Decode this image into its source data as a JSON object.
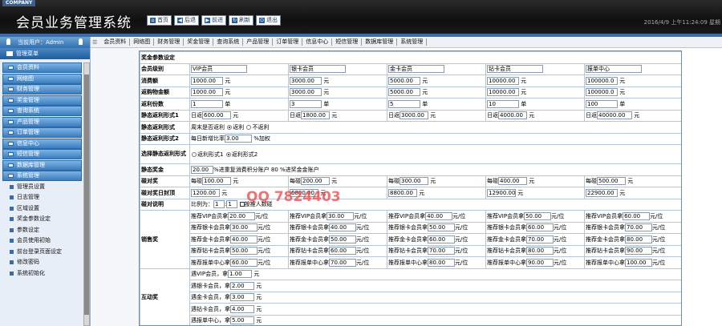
{
  "header": {
    "company": "COMPANY",
    "title": "会员业务管理系统",
    "nav": [
      "首页",
      "后退",
      "前进",
      "刷新",
      "退出"
    ],
    "datetime": "2016/4/9 上午11:24:09 星期"
  },
  "sidebar": {
    "user": "当前用户：Admin",
    "title": "管理菜单",
    "menu": [
      "会员资料",
      "网络图",
      "财务管理",
      "奖金管理",
      "查询系统",
      "产品管理",
      "订单管理",
      "信息中心",
      "短信管理",
      "数据库管理",
      "系统管理"
    ],
    "sub": [
      "管理员设置",
      "日志管理",
      "区域设置",
      "奖金参数设定",
      "参数设定",
      "会员使用初始",
      "前台登录页面设定",
      "修改密码",
      "系统初始化"
    ]
  },
  "tabs": [
    "会员资料",
    "网络图",
    "财务管理",
    "奖金管理",
    "查询系统",
    "产品管理",
    "订单管理",
    "信息中心",
    "短信管理",
    "数据库管理",
    "系统管理"
  ],
  "form": {
    "section": "奖金参数设定",
    "rows": {
      "level": {
        "label": "会员级别",
        "values": [
          "VIP会员",
          "银卡会员",
          "金卡会员",
          "钻卡会员",
          "报单中心"
        ]
      },
      "consume": {
        "label": "消费额",
        "values": [
          "1000.00",
          "3000.00",
          "5000.00",
          "10000.00",
          "100000.0"
        ],
        "unit": "元"
      },
      "repurchase": {
        "label": "返购物金额",
        "values": [
          "1000.00",
          "3000.00",
          "5000.00",
          "10000.00",
          "100000.0"
        ],
        "unit": "元"
      },
      "share": {
        "label": "返利份数",
        "values": [
          "1",
          "3",
          "5",
          "10",
          "100"
        ],
        "unit": "单"
      },
      "static1": {
        "label": "静态返利形式1",
        "prefix": "日返",
        "values": [
          "600.00",
          "1800.00",
          "3000.00",
          "4000.00",
          "40000.00"
        ],
        "unit": "元"
      },
      "static_mode": {
        "label": "静态返利形式",
        "text": "周末是否返利",
        "opt1": "返利",
        "opt2": "不返利"
      },
      "static2": {
        "label": "静态返利形式2",
        "text": "每日新增比率",
        "value": "3.00",
        "unit": "%加权"
      },
      "select_static": {
        "label": "选择静态返利形式",
        "opt1": "返利形式1",
        "opt2": "返利形式2"
      },
      "static_bonus": {
        "label": "静态奖金",
        "value": "20.00",
        "text": "%进重复消费积分账户 80 %进奖金金账户"
      },
      "pair": {
        "label": "碰对奖",
        "prefix": "每碰",
        "values": [
          "100.00",
          "200.00",
          "300.00",
          "400.00",
          "500.00"
        ],
        "unit": "元"
      },
      "cap": {
        "label": "碰对奖日封顶",
        "values": [
          "1200.00",
          "6800.00",
          "8800.00",
          "12900.00",
          "22900.00"
        ],
        "unit": "元"
      },
      "pair_desc": {
        "label": "碰对说明",
        "text1": "比例为：",
        "v1": "1",
        "text2": ":",
        "v2": "1",
        "text3": "按推人数碰"
      },
      "sales": {
        "label": "销售奖",
        "unit": "元/位",
        "rows": [
          [
            "推荐VIP会员拿",
            "20.00",
            "推荐VIP会员拿",
            "30.00",
            "推荐VIP会员拿",
            "40.00",
            "推荐VIP会员拿",
            "50.00",
            "推荐VIP会员拿",
            "60.00"
          ],
          [
            "推荐银卡会员拿",
            "30.00",
            "推荐银卡会员拿",
            "40.00",
            "推荐银卡会员拿",
            "50.00",
            "推荐银卡会员拿",
            "60.00",
            "推荐银卡会员拿",
            "70.00"
          ],
          [
            "推荐金卡会员拿",
            "40.00",
            "推荐金卡会员拿",
            "50.00",
            "推荐金卡会员拿",
            "60.00",
            "推荐金卡会员拿",
            "70.00",
            "推荐金卡会员拿",
            "80.00"
          ],
          [
            "推荐钻卡会员拿",
            "50.00",
            "推荐钻卡会员拿",
            "60.00",
            "推荐钻卡会员拿",
            "70.00",
            "推荐钻卡会员拿",
            "80.00",
            "推荐钻卡会员拿",
            "90.00"
          ],
          [
            "推荐报单中心拿",
            "60.00",
            "推荐报单中心拿",
            "70.00",
            "推荐报单中心拿",
            "80.00",
            "推荐报单中心拿",
            "90.00",
            "推荐报单中心拿",
            "100.00"
          ]
        ]
      },
      "mutual": {
        "label": "互动奖",
        "unit": "元",
        "rows": [
          [
            "遇VIP会员，拿",
            "1.00"
          ],
          [
            "遇银卡会员，拿",
            "2.00"
          ],
          [
            "遇金卡会员，拿",
            "3.00"
          ],
          [
            "遇钻卡会员，拿",
            "4.00"
          ],
          [
            "遇报单中心，拿",
            "5.00"
          ]
        ]
      }
    }
  },
  "watermark": "QQ 7824403"
}
